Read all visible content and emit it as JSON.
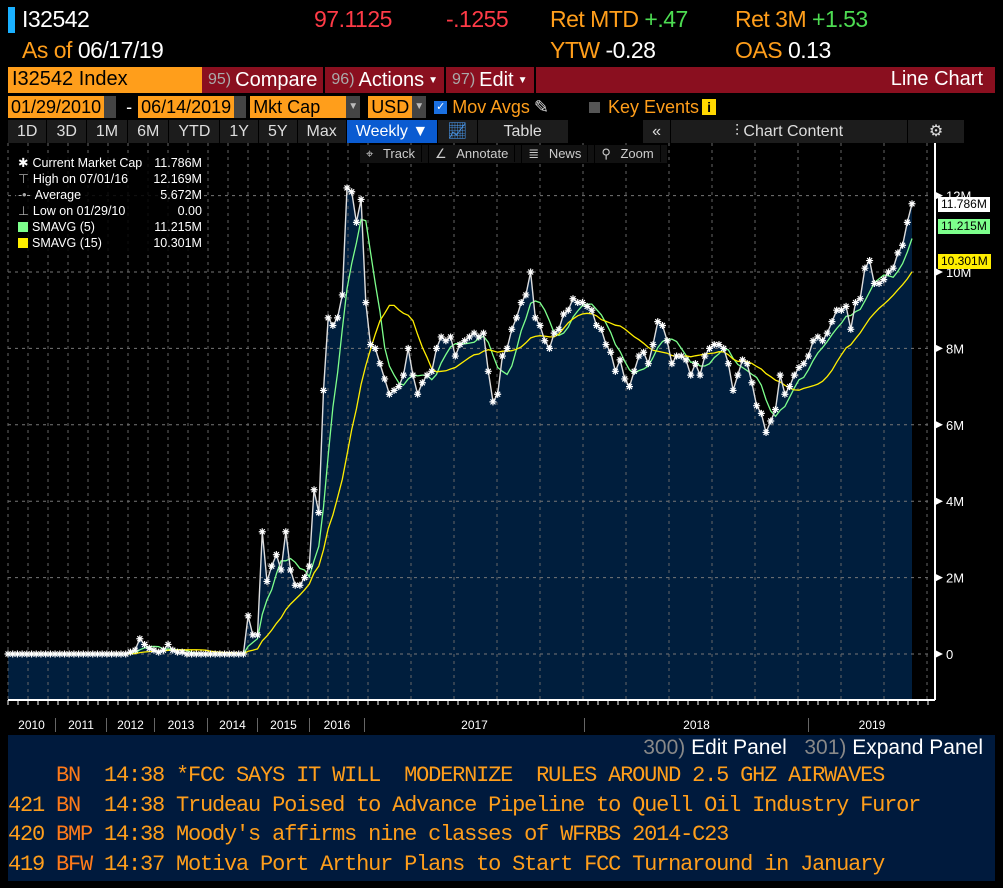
{
  "header": {
    "ticker": "I32542",
    "price": "97.1125",
    "change": "-.1255",
    "ret_mtd_label": "Ret MTD",
    "ret_mtd": "+.47",
    "ret_3m_label": "Ret 3M",
    "ret_3m": "+1.53",
    "as_of_label": "As of",
    "as_of": "06/17/19",
    "ytw_label": "YTW",
    "ytw": "-0.28",
    "oas_label": "OAS",
    "oas": "0.13"
  },
  "menu": {
    "security": "I32542 Index",
    "buttons": [
      {
        "num": "95)",
        "label": "Compare"
      },
      {
        "num": "96)",
        "label": "Actions",
        "dropdown": true
      },
      {
        "num": "97)",
        "label": "Edit",
        "dropdown": true
      }
    ],
    "title": "Line Chart"
  },
  "controls": {
    "start_date": "01/29/2010",
    "end_date": "06/14/2019",
    "field": "Mkt Cap",
    "currency": "USD",
    "mov_avgs_label": "Mov Avgs",
    "mov_avgs_checked": true,
    "key_events_label": "Key Events",
    "key_events_checked": false
  },
  "periods": [
    "1D",
    "3D",
    "1M",
    "6M",
    "YTD",
    "1Y",
    "5Y",
    "Max"
  ],
  "frequency": "Weekly ▼",
  "table_label": "Table",
  "chart_content_label": "Chart Content",
  "tools": [
    "Track",
    "Annotate",
    "News",
    "Zoom"
  ],
  "legend": [
    {
      "icon": "asterisk-icon",
      "label": "Current Market Cap",
      "value": "11.786M"
    },
    {
      "icon": "high-icon",
      "label": "High on 07/01/16",
      "value": "12.169M"
    },
    {
      "icon": "average-icon",
      "label": "Average",
      "value": "5.672M"
    },
    {
      "icon": "low-icon",
      "label": "Low on 01/29/10",
      "value": "0.00"
    },
    {
      "icon": "swatch",
      "color": "#7dff8c",
      "label": "SMAVG (5)",
      "value": "11.215M"
    },
    {
      "icon": "swatch",
      "color": "#ffee00",
      "label": "SMAVG (15)",
      "value": "10.301M"
    }
  ],
  "chart_data": {
    "type": "line",
    "frequency": "weekly",
    "ylim": [
      0,
      12.8
    ],
    "y_unit": "M",
    "yticks": [
      "0",
      "2M",
      "4M",
      "6M",
      "8M",
      "10M",
      "12M"
    ],
    "year_labels": [
      "2010",
      "2011",
      "2012",
      "2013",
      "2014",
      "2015",
      "2016",
      "2017",
      "2018",
      "2019"
    ],
    "series": [
      {
        "name": "Current Market Cap",
        "color": "#ffffff",
        "values": [
          0,
          0,
          0,
          0,
          0,
          0,
          0,
          0,
          0,
          0,
          0,
          0,
          0,
          0,
          0,
          0,
          0,
          0,
          0,
          0,
          0,
          0,
          0,
          0,
          0,
          0,
          0.05,
          0.1,
          0.4,
          0.25,
          0.15,
          0.1,
          0.05,
          0.1,
          0.25,
          0.1,
          0.05,
          0.05,
          0,
          0,
          0,
          0,
          0,
          0,
          0,
          0,
          0,
          0,
          0,
          0,
          0,
          1.0,
          0.5,
          0.5,
          3.2,
          1.9,
          2.3,
          2.6,
          2.2,
          3.2,
          2.2,
          1.8,
          1.8,
          2.0,
          2.3,
          4.3,
          3.7,
          6.9,
          8.8,
          8.6,
          8.8,
          9.4,
          12.2,
          12.1,
          11.3,
          11.9,
          9.2,
          8.1,
          8.0,
          7.6,
          7.2,
          6.8,
          6.9,
          7.0,
          7.3,
          8.0,
          7.3,
          6.8,
          7.1,
          7.3,
          7.4,
          8.0,
          8.3,
          8.2,
          8.3,
          7.8,
          8.1,
          8.2,
          8.3,
          8.4,
          8.3,
          8.4,
          7.4,
          6.6,
          6.8,
          7.8,
          8.0,
          8.5,
          8.8,
          9.2,
          9.4,
          10.0,
          8.8,
          8.6,
          8.2,
          8.0,
          8.4,
          8.5,
          8.9,
          9.0,
          9.3,
          9.2,
          9.2,
          9.1,
          9.0,
          8.6,
          8.5,
          8.1,
          7.9,
          7.4,
          7.7,
          7.2,
          7.0,
          7.4,
          7.8,
          7.9,
          7.6,
          8.1,
          8.7,
          8.6,
          8.2,
          7.6,
          7.8,
          7.8,
          7.7,
          7.3,
          7.6,
          7.3,
          7.8,
          8.0,
          8.1,
          8.1,
          8.0,
          7.6,
          6.9,
          7.3,
          7.7,
          7.6,
          7.1,
          6.5,
          6.3,
          5.8,
          6.1,
          6.4,
          7.3,
          6.8,
          7.0,
          7.3,
          7.5,
          7.6,
          7.8,
          8.2,
          8.3,
          8.2,
          8.4,
          8.7,
          9.0,
          9.0,
          9.1,
          8.5,
          9.2,
          9.3,
          10.1,
          10.3,
          9.7,
          9.7,
          9.8,
          10.0,
          10.1,
          10.5,
          10.7,
          11.3,
          11.786
        ]
      },
      {
        "name": "SMAVG (5)",
        "color": "#7dff8c",
        "last": 11.215
      },
      {
        "name": "SMAVG (15)",
        "color": "#ffee00",
        "last": 10.301
      }
    ],
    "grid": true,
    "area_fill": "#001e3d"
  },
  "value_tags": [
    "11.786M",
    "11.215M",
    "10.301M"
  ],
  "panel": {
    "edit_num": "300)",
    "edit_label": "Edit Panel",
    "expand_num": "301)",
    "expand_label": "Expand Panel"
  },
  "news": [
    {
      "num": "",
      "src": "BN",
      "time": "14:38",
      "headline": "*FCC SAYS IT WILL  MODERNIZE  RULES AROUND 2.5 GHZ AIRWAVES"
    },
    {
      "num": "421",
      "src": "BN",
      "time": "14:38",
      "headline": "Trudeau Poised to Advance Pipeline to Quell Oil Industry Furor"
    },
    {
      "num": "420",
      "src": "BMP",
      "time": "14:38",
      "headline": "Moody's affirms nine classes of WFRBS 2014-C23"
    },
    {
      "num": "419",
      "src": "BFW",
      "time": "14:37",
      "headline": "Motiva Port Arthur Plans to Start FCC Turnaround in January"
    }
  ]
}
